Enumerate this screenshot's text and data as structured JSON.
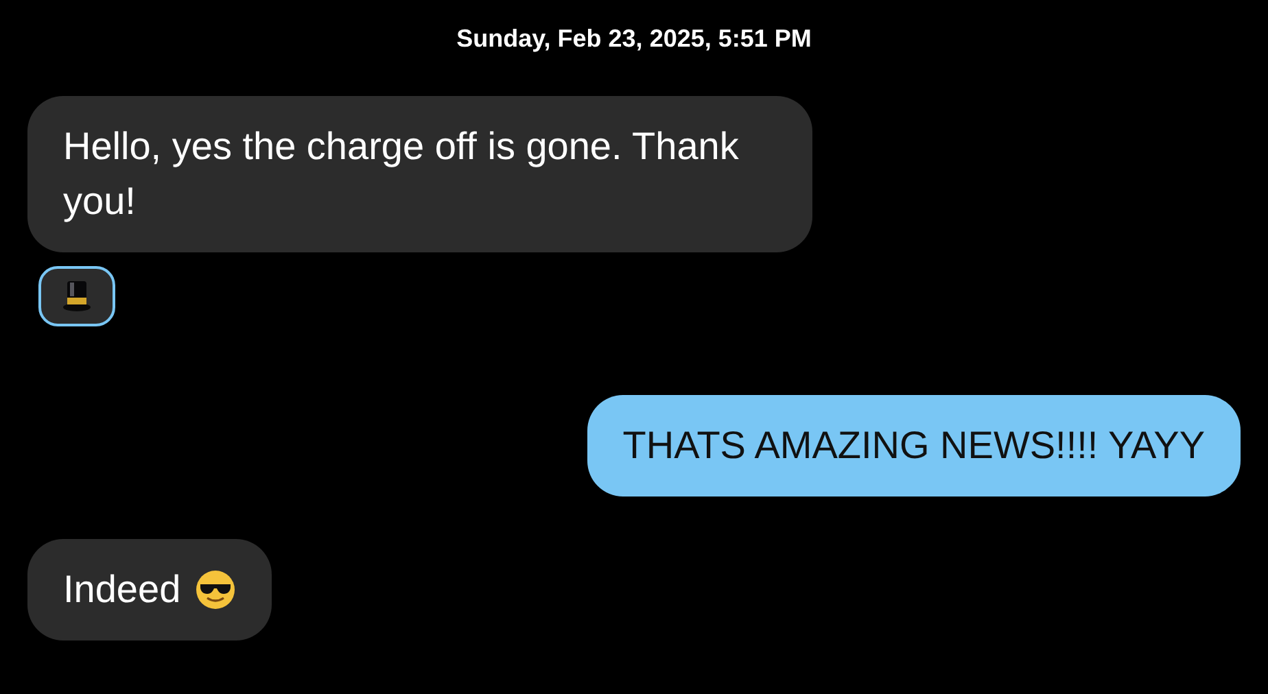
{
  "timestamp": "Sunday, Feb 23, 2025, 5:51 PM",
  "messages": [
    {
      "kind": "incoming",
      "text": "Hello, yes the charge off is gone. Thank you!",
      "reaction": true,
      "sunglasses_emoji": false
    },
    {
      "kind": "outgoing",
      "text": "THATS AMAZING NEWS!!!! YAYY",
      "reaction": false,
      "sunglasses_emoji": false
    },
    {
      "kind": "incoming",
      "text": "Indeed",
      "reaction": false,
      "sunglasses_emoji": true
    }
  ]
}
